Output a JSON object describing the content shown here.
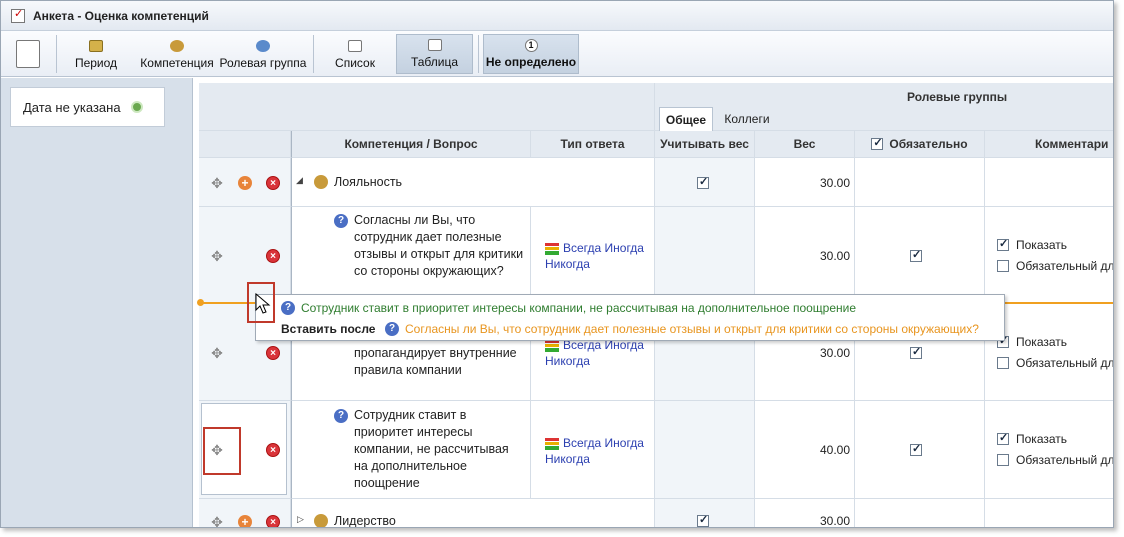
{
  "window": {
    "title": "Анкета - Оценка компетенций"
  },
  "toolbar": {
    "period": "Период",
    "competence": "Компетенция",
    "role_group": "Ролевая группа",
    "list": "Список",
    "table": "Таблица",
    "undefined_count": "1",
    "undefined": "Не определено"
  },
  "sidebar": {
    "date_item": "Дата не указана"
  },
  "grid": {
    "role_groups_header": "Ролевые группы",
    "tabs": [
      "Общее",
      "Коллеги"
    ],
    "columns": {
      "question": "Компетенция / Вопрос",
      "answer_type": "Тип ответа",
      "use_weight": "Учитывать вес",
      "weight": "Вес",
      "required": "Обязательно",
      "comment": "Комментари"
    },
    "rows": [
      {
        "type": "competence",
        "title": "Лояльность",
        "use_weight": true,
        "weight": "30.00"
      },
      {
        "type": "question",
        "text": "Согласны ли Вы, что сотрудник дает полезные отзывы и открыт для критики со стороны окружающих?",
        "answer": "Всегда Иногда Никогда",
        "weight": "30.00",
        "required": true,
        "show": "Показать",
        "show_checked": true,
        "req_comment": "Обязательный дл",
        "req_comment_checked": false
      },
      {
        "type": "question",
        "text": "пропагандирует внутренние правила компании",
        "answer": "Всегда Иногда Никогда",
        "weight": "30.00",
        "required": true,
        "show": "Показать",
        "show_checked": true,
        "req_comment": "Обязательный дл",
        "req_comment_checked": false
      },
      {
        "type": "question",
        "text": "Сотрудник ставит в приоритет интересы компании, не рассчитывая на дополнительное поощрение",
        "answer": "Всегда Иногда Никогда",
        "weight": "40.00",
        "required": true,
        "show": "Показать",
        "show_checked": true,
        "req_comment": "Обязательный дл",
        "req_comment_checked": false
      },
      {
        "type": "competence",
        "title": "Лидерство",
        "use_weight": true,
        "weight": "30.00"
      }
    ]
  },
  "drag_tooltip": {
    "dragged": "Сотрудник ставит в приоритет интересы компании, не рассчитывая на дополнительное поощрение",
    "insert_label": "Вставить после",
    "target": "Согласны ли Вы, что сотрудник дает полезные отзывы и открыт для критики со стороны окружающих?",
    "dragged_color": "#2f7d2f",
    "target_color": "#e8951f"
  },
  "colors": {
    "accent": "#c0392b",
    "drop_line": "#f0a020",
    "link": "#2b3fb0"
  }
}
